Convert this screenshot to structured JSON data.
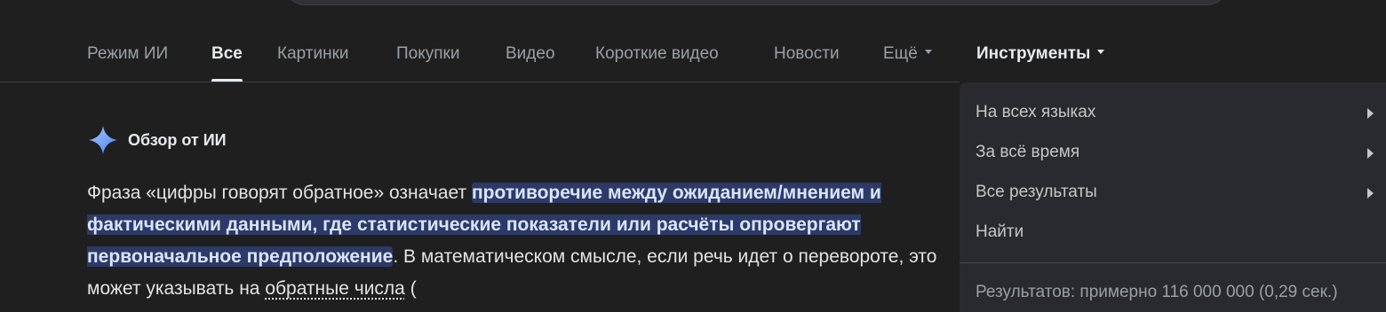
{
  "tabs": [
    {
      "label": "Режим ИИ"
    },
    {
      "label": "Все"
    },
    {
      "label": "Картинки"
    },
    {
      "label": "Покупки"
    },
    {
      "label": "Видео"
    },
    {
      "label": "Короткие видео"
    },
    {
      "label": "Новости"
    },
    {
      "label": "Ещё"
    }
  ],
  "tools_label": "Инструменты",
  "ai_overview": {
    "title": "Обзор от ИИ",
    "icon": "sparkle-icon",
    "text_1": "Фраза «цифры говорят обратное» означает ",
    "highlight": "противоречие между ожиданием/мнением и фактическими данными, где статистические показатели или расчёты опровергают первоначальное предположение",
    "text_2": ". В математическом смысле, если речь идет о перевороте, это может указывать на ",
    "link": "обратные числа",
    "text_3": " ("
  },
  "tools_menu": {
    "items": [
      {
        "label": "На всех языках",
        "has_submenu": true
      },
      {
        "label": "За всё время",
        "has_submenu": true
      },
      {
        "label": "Все результаты",
        "has_submenu": true
      },
      {
        "label": "Найти",
        "has_submenu": false
      }
    ],
    "stats": "Результатов: примерно 116 000 000 (0,29 сек.)"
  },
  "colors": {
    "background": "#1f1f1f",
    "highlight_bg": "#2b3a66",
    "menu_bg": "#292a2d",
    "spark": "#8ab4f8"
  }
}
